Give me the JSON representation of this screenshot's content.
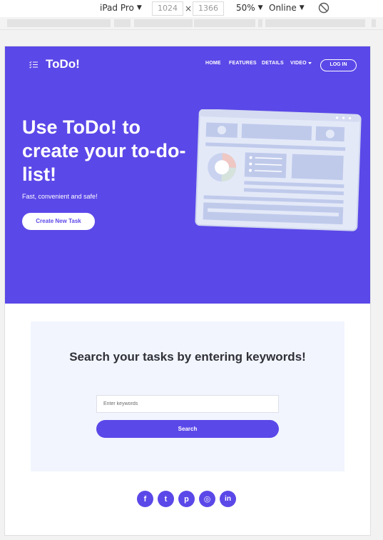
{
  "devtools": {
    "device": "iPad Pro",
    "width": "1024",
    "height": "1366",
    "times": "×",
    "zoom": "50%",
    "network": "Online",
    "dropdown_glyph": "▼"
  },
  "header": {
    "logo_text": "ToDo!",
    "nav": [
      "HOME",
      "FEATURES",
      "DETAILS",
      "VIDEO"
    ],
    "login_label": "LOG IN"
  },
  "hero": {
    "title": "Use ToDo! to create your to-do-list!",
    "subtitle": "Fast, convenient and safe!",
    "cta_label": "Create New Task"
  },
  "search": {
    "title": "Search your tasks by entering keywords!",
    "placeholder": "Enter keywords",
    "button_label": "Search"
  },
  "socials": [
    {
      "icon": "facebook-icon",
      "glyph": "f"
    },
    {
      "icon": "twitter-icon",
      "glyph": "t"
    },
    {
      "icon": "pinterest-icon",
      "glyph": "p"
    },
    {
      "icon": "instagram-icon",
      "glyph": "◎"
    },
    {
      "icon": "linkedin-icon",
      "glyph": "in"
    }
  ],
  "colors": {
    "brand": "#5b48e8",
    "card_bg": "#f2f5fe"
  }
}
